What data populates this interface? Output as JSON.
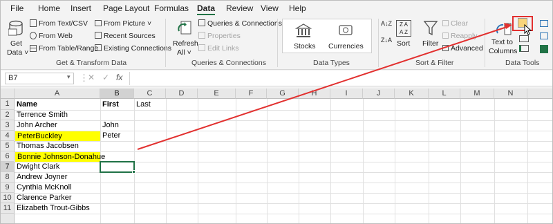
{
  "menu_tabs": [
    "File",
    "Home",
    "Insert",
    "Page Layout",
    "Formulas",
    "Data",
    "Review",
    "View",
    "Help"
  ],
  "active_tab": "Data",
  "ribbon": {
    "get_data": [
      "Get",
      "Data ˅"
    ],
    "from_text_csv": "From Text/CSV",
    "from_web": "From Web",
    "from_table_range": "From Table/Range",
    "from_picture": "From Picture ˅",
    "recent_sources": "Recent Sources",
    "existing_connections": "Existing Connections",
    "group_get_transform": "Get & Transform Data",
    "refresh_all": [
      "Refresh",
      "All ˅"
    ],
    "queries_connections": "Queries & Connections",
    "properties": "Properties",
    "edit_links": "Edit Links",
    "group_queries": "Queries & Connections",
    "stocks": "Stocks",
    "currencies": "Currencies",
    "group_data_types": "Data Types",
    "sort": "Sort",
    "filter": "Filter",
    "clear": "Clear",
    "reapply": "Reapply",
    "advanced": "Advanced",
    "group_sort_filter": "Sort & Filter",
    "text_to_columns": [
      "Text to",
      "Columns"
    ],
    "group_data_tools": "Data Tools",
    "sort_az": "A↓Z",
    "sort_za": "Z↓A"
  },
  "formula_bar": {
    "name_box": "B7",
    "fx": "fx",
    "formula": ""
  },
  "columns": [
    "A",
    "B",
    "C",
    "D",
    "E",
    "F",
    "G",
    "H",
    "I",
    "J",
    "K",
    "L",
    "M",
    "N"
  ],
  "rows": [
    "1",
    "2",
    "3",
    "4",
    "5",
    "6",
    "7",
    "8",
    "9",
    "10",
    "11"
  ],
  "cells": {
    "a1": "Name",
    "b1": "First",
    "c1": "Last",
    "a2": "Terrence Smith",
    "a3": "John Archer",
    "b3": "John",
    "a4": "PeterBuckley",
    "b4": "Peter",
    "a5": "Thomas Jacobsen",
    "a6": "Bonnie Johnson-Donahue",
    "a7": "Dwight Clark",
    "a8": "Andrew Joyner",
    "a9": "Cynthia McKnoll",
    "a10": "Clarence Parker",
    "a11": "Elizabeth Trout-Gibbs"
  },
  "colors": {
    "accent": "#217346",
    "highlight": "#ffff00",
    "arrow": "#e2302f",
    "selection": "#1f7145"
  }
}
